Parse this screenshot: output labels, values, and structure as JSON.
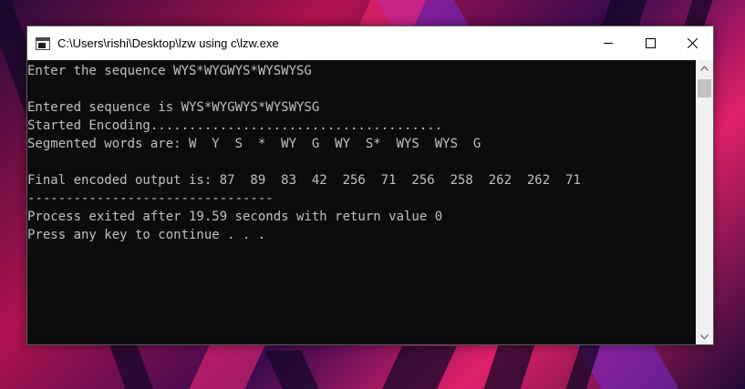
{
  "window": {
    "title": "C:\\Users\\rishi\\Desktop\\lzw using c\\lzw.exe",
    "controls": [
      "minimize",
      "maximize",
      "close"
    ]
  },
  "console": {
    "lines": [
      "Enter the sequence WYS*WYGWYS*WYSWYSG",
      "",
      "Entered sequence is WYS*WYGWYS*WYSWYSG",
      "Started Encoding......................................",
      "Segmented words are: W  Y  S  *  WY  G  WY  S*  WYS  WYS  G",
      "",
      "Final encoded output is: 87  89  83  42  256  71  256  258  262  262  71",
      "--------------------------------",
      "Process exited after 19.59 seconds with return value 0",
      "Press any key to continue . . ."
    ],
    "text_color": "#c0c0c0",
    "background": "#0c0c0c"
  }
}
